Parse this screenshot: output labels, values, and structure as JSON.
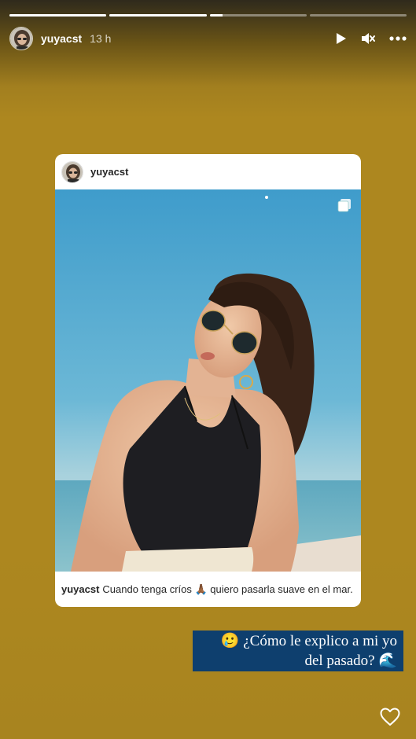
{
  "story": {
    "progress": [
      1.0,
      1.0,
      0.13,
      0.0
    ]
  },
  "header": {
    "username": "yuyacst",
    "time": "13 h",
    "icons": [
      "play-icon",
      "mute-icon",
      "more-icon"
    ]
  },
  "post": {
    "username": "yuyacst",
    "caption_user": "yuyacst",
    "caption_text": "Cuando tenga críos 🙏🏾 quiero pasarla suave en el mar."
  },
  "sticker": {
    "line1": "🥲 ¿Cómo le explico a mi yo",
    "line2": "del pasado? 🌊"
  },
  "colors": {
    "background": "#ad871f",
    "sticker_bg": "#0e3f6e",
    "sky": "#4fa6cf",
    "sea": "#6fb3c4"
  }
}
